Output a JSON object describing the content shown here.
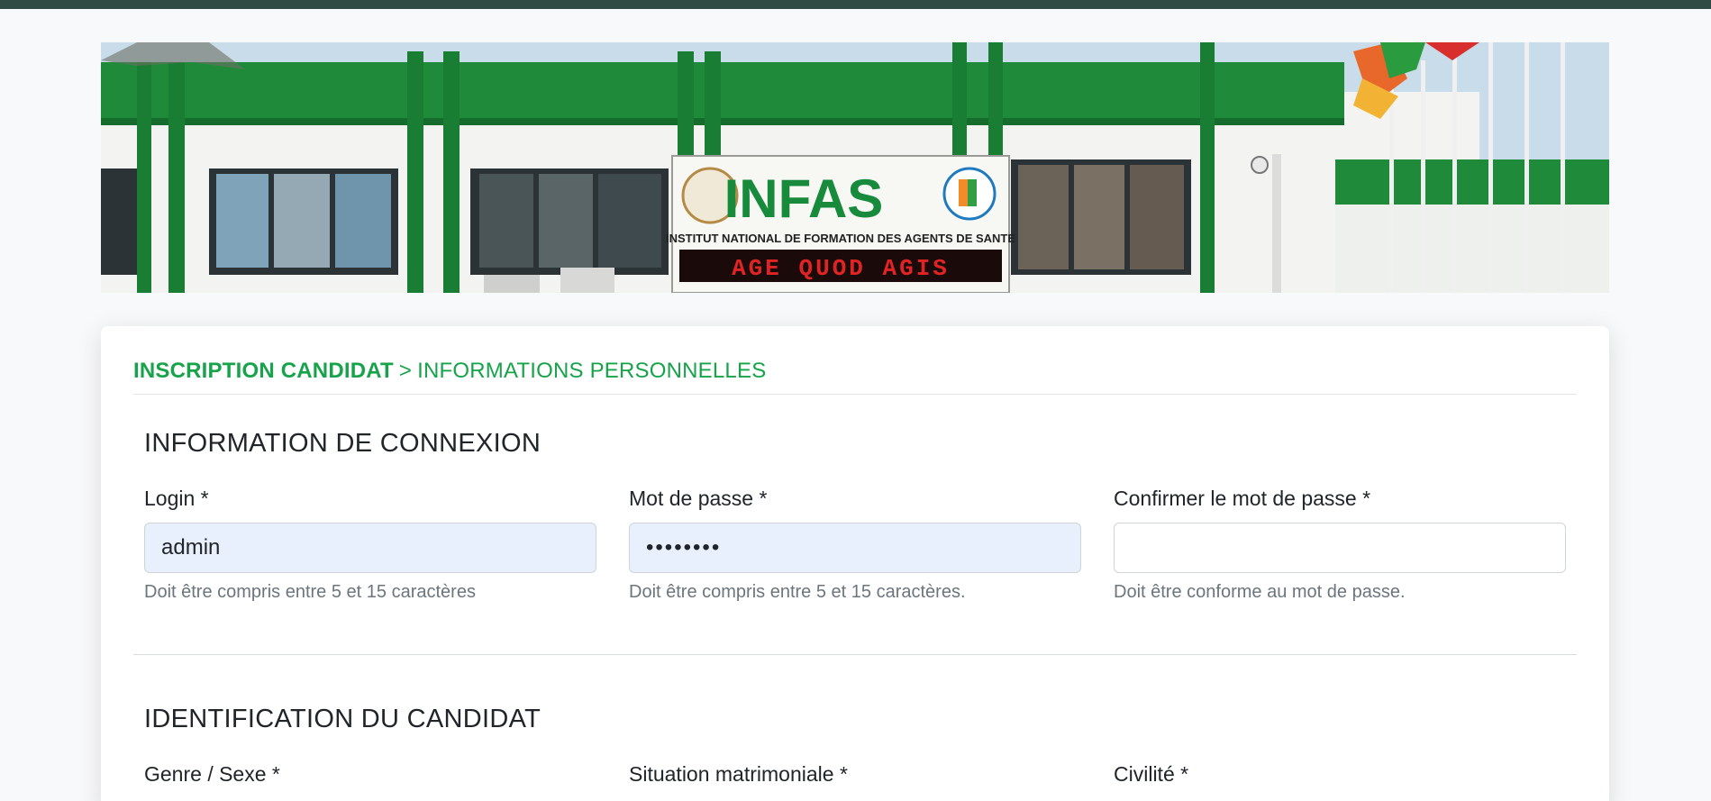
{
  "breadcrumb": {
    "step": "INSCRIPTION CANDIDAT",
    "separator": ">",
    "current": "INFORMATIONS PERSONNELLES"
  },
  "banner": {
    "sign_title": "INFAS",
    "sign_subtitle": "INSTITUT NATIONAL DE FORMATION DES AGENTS DE SANTE",
    "sign_motto": "AGE QUOD AGIS"
  },
  "connexion": {
    "title": "INFORMATION DE CONNEXION",
    "login": {
      "label": "Login *",
      "value": "admin",
      "help": "Doit être compris entre 5 et 15 caractères"
    },
    "password": {
      "label": "Mot de passe *",
      "value": "••••••••",
      "help": "Doit être compris entre 5 et 15 caractères."
    },
    "confirm": {
      "label": "Confirmer le mot de passe *",
      "value": "",
      "help": "Doit être conforme au mot de passe."
    }
  },
  "identification": {
    "title": "IDENTIFICATION DU CANDIDAT",
    "gender_label": "Genre / Sexe *",
    "marital_label": "Situation matrimoniale *",
    "civility_label": "Civilité *"
  },
  "colors": {
    "accent": "#16a34a",
    "autofill_bg": "#e8f0fe",
    "top_strip": "#2f4a45"
  }
}
